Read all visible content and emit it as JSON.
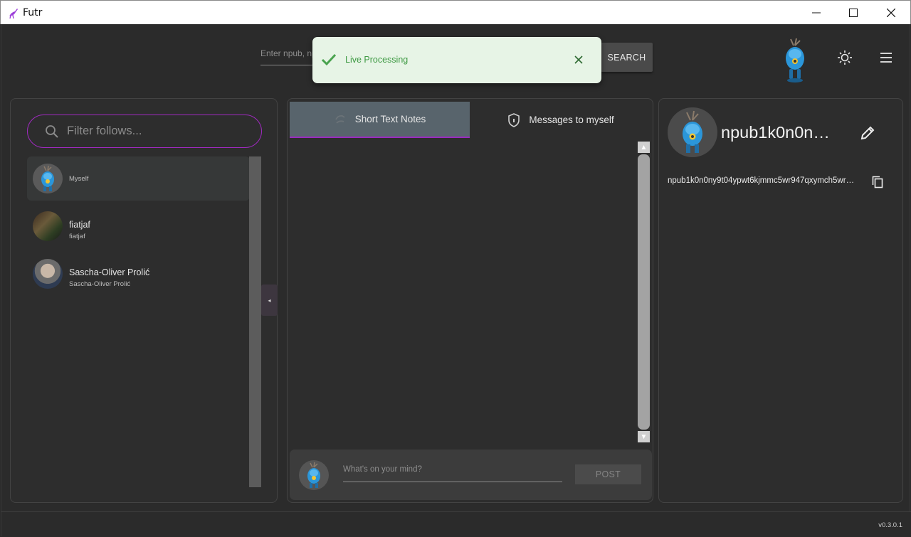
{
  "window": {
    "title": "Futr"
  },
  "header": {
    "search_placeholder": "Enter npub, np",
    "search_button": "SEARCH",
    "toast_message": "Live Processing"
  },
  "follows": {
    "filter_placeholder": "Filter follows...",
    "items": [
      {
        "name": "",
        "subtitle": "Myself"
      },
      {
        "name": "fiatjaf",
        "subtitle": "fiatjaf"
      },
      {
        "name": "Sascha-Oliver Prolić",
        "subtitle": "Sascha-Oliver Prolić"
      }
    ],
    "collapse_glyph": "◂"
  },
  "feed": {
    "tabs": [
      {
        "label": "Short Text Notes"
      },
      {
        "label": "Messages to myself"
      }
    ],
    "compose_placeholder": "What's on your mind?",
    "post_button": "POST"
  },
  "profile": {
    "display_name": "npub1k0n0n…",
    "pubkey": "npub1k0n0ny9t04ypwt6kjmmc5wr947qxymch5wr…"
  },
  "footer": {
    "version": "v0.3.0.1"
  },
  "colors": {
    "accent": "#9b2bc0",
    "active_tab": "#58646c",
    "toast_bg": "#e7f4e6",
    "toast_text": "#3f9a44"
  }
}
